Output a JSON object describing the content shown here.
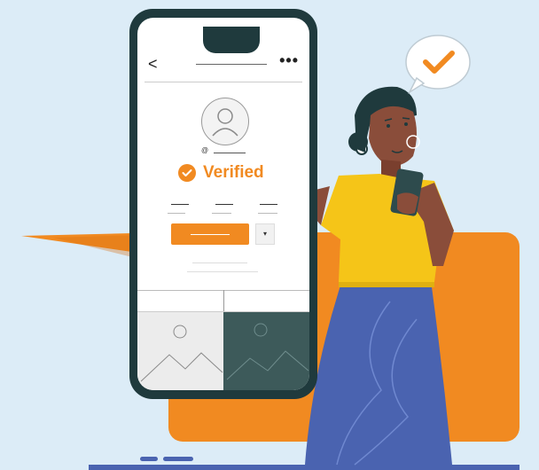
{
  "profile": {
    "handle_symbol": "@",
    "verified_label": "Verified",
    "nav_more": "•••",
    "nav_back": "<",
    "dropdown_caret": "▾"
  },
  "colors": {
    "background": "#dcecf7",
    "accent_orange": "#f18a21",
    "phone_frame": "#1f3a3d",
    "skirt_blue": "#4a63b0",
    "shirt_yellow": "#f5c518",
    "skin": "#8a4d3a"
  },
  "icons": {
    "back": "chevron-left-icon",
    "more": "more-dots-icon",
    "verified": "check-circle-icon",
    "bubble": "checkmark-icon",
    "avatar": "user-avatar-icon",
    "image_placeholder": "image-placeholder-icon"
  }
}
